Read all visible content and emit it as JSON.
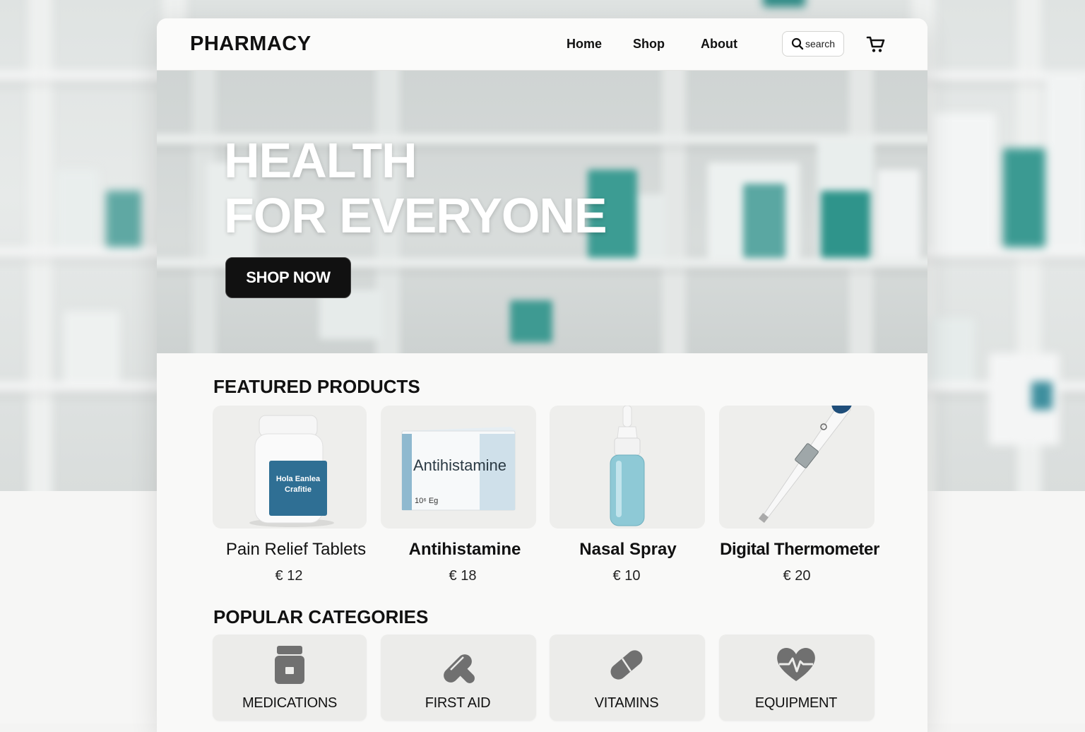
{
  "brand": "PHARMACY",
  "nav": {
    "links": [
      "Home",
      "Shop",
      "About"
    ],
    "search_placeholder": "search",
    "cart_icon": "cart-icon"
  },
  "hero": {
    "title_line1": "HEALTH",
    "title_line2": "FOR EVERYONE",
    "cta": "SHOP NOW"
  },
  "featured": {
    "title": "FEATURED PRODUCTS",
    "products": [
      {
        "name": "Pain Relief Tablets",
        "price": "€ 12",
        "image": "pill-bottle",
        "packaging_text": [
          "Hola Eanlea",
          "Crafitie"
        ]
      },
      {
        "name": "Antihistamine",
        "price": "€ 18",
        "image": "medicine-box",
        "packaging_text": [
          "Antihistamine",
          "10⁶ Eg"
        ]
      },
      {
        "name": "Nasal Spray",
        "price": "€ 10",
        "image": "nasal-spray-bottle"
      },
      {
        "name": "Digital Thermometer",
        "price": "€ 20",
        "image": "digital-thermometer"
      }
    ]
  },
  "categories": {
    "title": "POPULAR CATEGORIES",
    "items": [
      {
        "label": "MEDICATIONS",
        "icon": "medicine-bottle-icon"
      },
      {
        "label": "FIRST AID",
        "icon": "bandage-icon"
      },
      {
        "label": "VITAMINS",
        "icon": "capsule-icon"
      },
      {
        "label": "EQUIPMENT",
        "icon": "heartbeat-icon"
      }
    ]
  },
  "colors": {
    "accent_teal": "#2a9d93",
    "label_blue": "#2f6f94",
    "cta_bg": "#111111",
    "icon_gray": "#707070"
  }
}
